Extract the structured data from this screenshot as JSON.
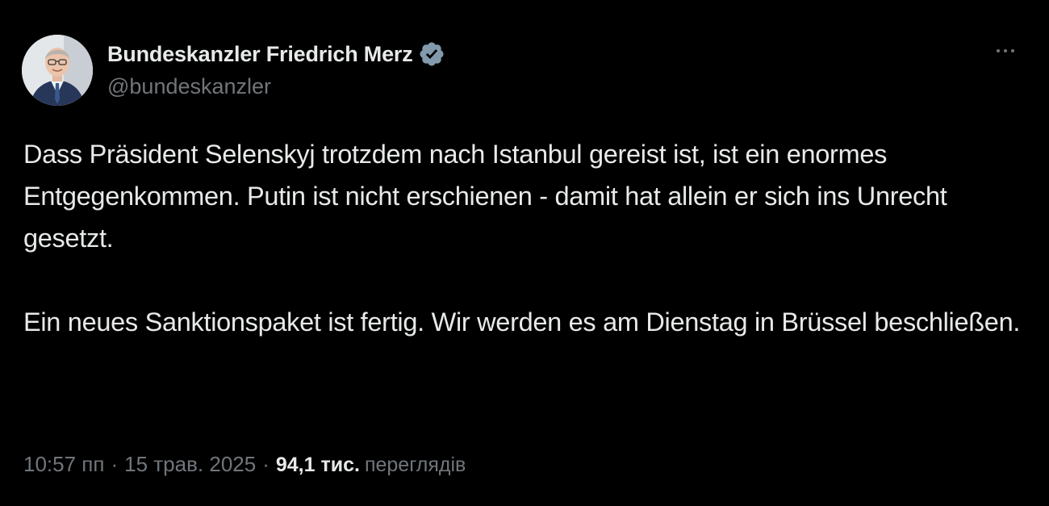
{
  "author": {
    "display_name": "Bundeskanzler Friedrich Merz",
    "handle": "@bundeskanzler",
    "verified": true,
    "verified_color": "#829aab"
  },
  "menu": {
    "more_icon": "more-horizontal-icon"
  },
  "tweet": {
    "paragraphs": [
      "Dass Präsident Selenskyj trotzdem nach Istanbul gereist ist, ist ein enormes Entgegenkommen. Putin ist nicht erschienen - damit hat allein er sich ins Unrecht gesetzt.",
      "Ein neues Sanktionspaket ist fertig. Wir werden es am Dienstag in Brüssel beschließen."
    ]
  },
  "meta": {
    "time": "10:57 пп",
    "separator": "·",
    "date": "15 трав. 2025",
    "views_count": "94,1 тис.",
    "views_label": "переглядів"
  },
  "colors": {
    "background": "#000000",
    "primary_text": "#e7e9ea",
    "secondary_text": "#71767b"
  }
}
